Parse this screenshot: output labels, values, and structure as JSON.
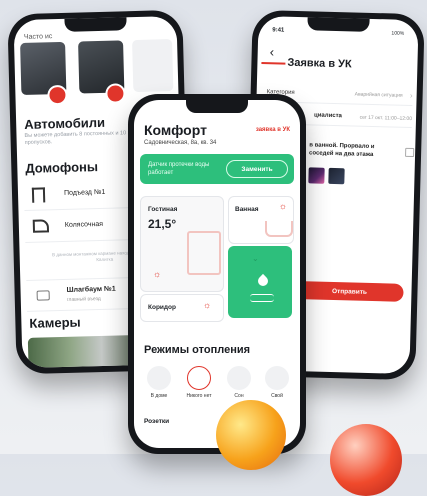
{
  "left_screen": {
    "top_label": "Часто ис",
    "cars_title": "Автомобили",
    "cars_desc": "Вы можете добавить 8 постоянных и 10 временных пропусков.",
    "intercoms_title": "Домофоны",
    "intercoms": [
      {
        "label": "Подъезд №1",
        "icon": "door-icon"
      },
      {
        "label": "Колясочная",
        "icon": "stroller-icon"
      }
    ],
    "hint_text": "В данном монтажном кармане находятся: Ворота, Калитка",
    "barrier": {
      "label": "Шлагбаум №1",
      "sub": "главный въезд",
      "icon": "barrier-icon"
    },
    "cameras_title": "Камеры"
  },
  "middle_screen": {
    "title": "Комфорт",
    "address": "Садовническая, 8а, кв. 34",
    "request_link": "заявка в УК",
    "banner_text": "Датчик протечки воды работает",
    "banner_button": "Заменить",
    "rooms": {
      "living": {
        "name": "Гостиная",
        "temp": "21,5°"
      },
      "bath": {
        "name": "Ванная"
      },
      "corridor": {
        "name": "Коридор"
      }
    },
    "heating_title": "Режимы отопления",
    "modes": [
      {
        "label": "В доме",
        "icon": "home-icon"
      },
      {
        "label": "Никого нет",
        "icon": "away-icon"
      },
      {
        "label": "Сон",
        "icon": "moon-icon"
      },
      {
        "label": "Свой",
        "icon": "custom-icon"
      }
    ],
    "sockets_title": "Розетки"
  },
  "right_screen": {
    "time": "9:41",
    "battery": "100%",
    "title": "Заявка в УК",
    "category_label": "Категория",
    "category_value": "Аварийная ситуация",
    "specialist_label": "циалиста",
    "specialist_value": "сег 17 окт. 11:00–12:00",
    "description": "в ванной. Прорвало и соседей на два этажа",
    "submit_label": "Отправить"
  },
  "colors": {
    "accent_red": "#e0352b",
    "accent_green": "#2dbf7c",
    "dark": "#1a1d22"
  }
}
